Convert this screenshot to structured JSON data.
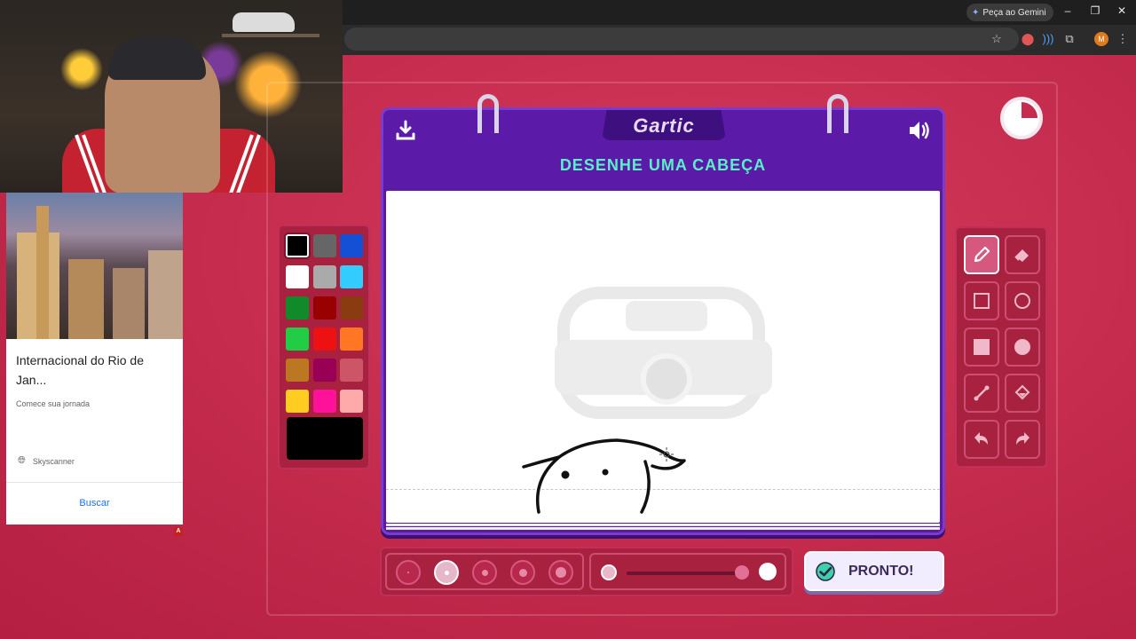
{
  "browser": {
    "gemini_label": "Peça ao Gemini",
    "profile_initial": "M"
  },
  "ad": {
    "title": "Internacional do Rio de Jan...",
    "subtitle": "Comece sua jornada",
    "brand": "Skyscanner",
    "cta": "Buscar",
    "badge": "A"
  },
  "game": {
    "logo": "Gartic",
    "prompt": "DESENHE UMA CABEÇA",
    "ready_label": "PRONTO!",
    "palette": [
      "#000000",
      "#666666",
      "#1450d6",
      "#ffffff",
      "#aaaaaa",
      "#33ccff",
      "#118a2a",
      "#990000",
      "#8a3c10",
      "#22cc44",
      "#ee1111",
      "#ff7722",
      "#bb7722",
      "#990055",
      "#cc5566",
      "#ffcc22",
      "#ff1199",
      "#ffaaaa"
    ],
    "selected_color": "#000000",
    "tools": [
      "pencil",
      "eraser",
      "rectangle-outline",
      "ellipse-outline",
      "rectangle-fill",
      "ellipse-fill",
      "line",
      "bucket",
      "undo",
      "redo"
    ],
    "selected_tool": "pencil",
    "brush_sizes": [
      "1",
      "2",
      "3",
      "4",
      "5"
    ],
    "selected_size": "2",
    "opacity": 1.0,
    "colors": {
      "accent": "#5b1aa8",
      "prompt": "#59f0c8",
      "background": "#c32a4c"
    }
  }
}
